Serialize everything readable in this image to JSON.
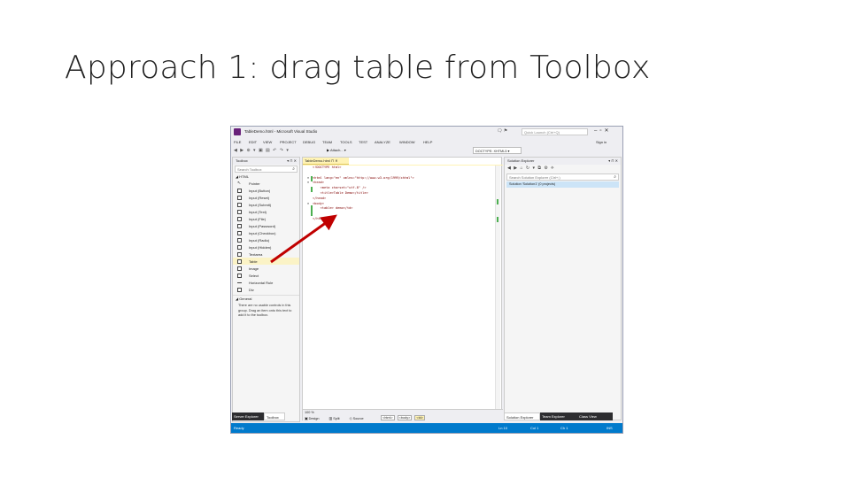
{
  "slide": {
    "title": "Approach 1: drag table from Toolbox"
  },
  "window": {
    "title": "TableDemo.html - Microsoft Visual Studio",
    "quick_launch_placeholder": "Quick Launch (Ctrl+Q)",
    "sign_in": "Sign in"
  },
  "menu": [
    "FILE",
    "EDIT",
    "VIEW",
    "PROJECT",
    "DEBUG",
    "TEAM",
    "TOOLS",
    "TEST",
    "ANALYZE",
    "WINDOW",
    "HELP"
  ],
  "toolbar": {
    "attach_label": "Attach...",
    "doctype_value": "DOCTYPE: XHTML5"
  },
  "toolbox": {
    "title": "Toolbox",
    "search_placeholder": "Search Toolbox",
    "group_html": "◢ HTML",
    "items": [
      "Pointer",
      "Input (Button)",
      "Input (Reset)",
      "Input (Submit)",
      "Input (Text)",
      "Input (File)",
      "Input (Password)",
      "Input (Checkbox)",
      "Input (Radio)",
      "Input (Hidden)",
      "Textarea",
      "Table",
      "Image",
      "Select",
      "Horizontal Rule",
      "Div"
    ],
    "selected_item": "Table",
    "group_general": "◢ General",
    "general_message": "There are no usable controls in this group. Drag an item onto this text to add it to the toolbox.",
    "tab_server_explorer": "Server Explorer",
    "tab_toolbox": "Toolbox"
  },
  "editor": {
    "tab_label": "TableDemo.html",
    "code": [
      "<!DOCTYPE html>",
      "",
      "<html lang=\"en\" xmlns=\"http://www.w3.org/1999/xhtml\">",
      "<head>",
      "    <meta charset=\"utf-8\" />",
      "    <title>Table Demo</title>",
      "</head>",
      "<body>",
      "    <table> demo</td>",
      "",
      "</html>"
    ],
    "zoom": "100 %",
    "view_design": "Design",
    "view_split": "Split",
    "view_source": "Source",
    "crumb_html": "<html>",
    "crumb_body": "<body>",
    "crumb_td": "<td>"
  },
  "solution_explorer": {
    "title": "Solution Explorer",
    "search_placeholder": "Search Solution Explorer (Ctrl+;)",
    "item": "Solution 'Solution1' (0 projects)",
    "tabs": [
      "Solution Explorer",
      "Team Explorer",
      "Class View"
    ]
  },
  "status": {
    "ready": "Ready",
    "line": "Ln 10",
    "col": "Col 1",
    "ch": "Ch 1",
    "mode": "INS"
  },
  "colors": {
    "accent": "#007acc",
    "vs_purple": "#68217a",
    "arrow": "#c00000"
  }
}
